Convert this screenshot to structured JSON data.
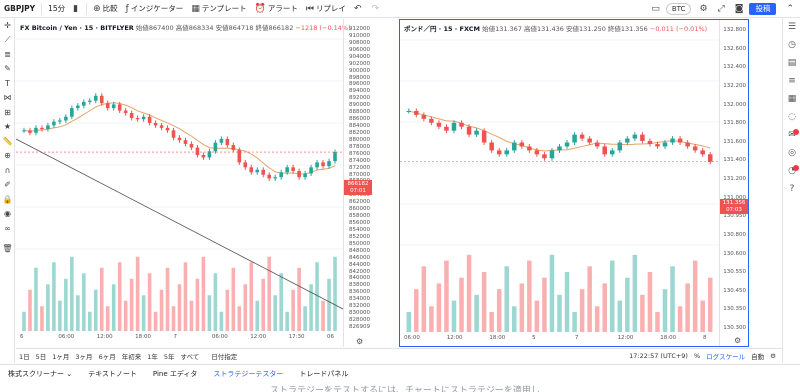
{
  "toolbar": {
    "symbol": "GBPJPY",
    "interval": "15分",
    "compare": "比較",
    "indicators": "インジケーター",
    "templates": "テンプレート",
    "alert": "アラート",
    "replay": "リプレイ",
    "currency": "BTC",
    "post": "投稿"
  },
  "pane1": {
    "legend_symbol": "FX Bitcoin / Yen · 15 · BITFLYER",
    "legend_values": "始値867400  高値868334  安値864718  終値866182",
    "legend_change": "−1218 (−0.14%)",
    "yticks": [
      "912000",
      "910000",
      "908000",
      "906000",
      "904000",
      "902000",
      "900000",
      "898000",
      "896000",
      "894000",
      "892000",
      "890000",
      "888000",
      "886000",
      "884000",
      "882000",
      "880000",
      "878000",
      "876000",
      "874000",
      "872000",
      "870000",
      "868000",
      "866000",
      "864000",
      "862000",
      "860000",
      "858000",
      "856000",
      "854000",
      "852000",
      "850000",
      "848000",
      "846000",
      "844000",
      "842000",
      "840000",
      "838000",
      "836000",
      "834000",
      "832000",
      "830000",
      "828000",
      "826909"
    ],
    "xticks": [
      "6",
      "06:00",
      "12:00",
      "18:00",
      "7",
      "06:00",
      "12:00",
      "17:30",
      "06"
    ],
    "price_tag": "866182",
    "price_tag_time": "07:01"
  },
  "pane2": {
    "legend_symbol": "ポンド／円 · 15 · FXCM",
    "legend_values": "始値131.367  高値131.436  安値131.250  終値131.356",
    "legend_change": "−0.011 (−0.01%)",
    "yticks": [
      "132.800",
      "132.600",
      "132.400",
      "132.200",
      "132.000",
      "131.800",
      "131.600",
      "131.400",
      "131.200",
      "131.000",
      "130.950",
      "130.800",
      "130.600",
      "130.550",
      "130.450",
      "130.350",
      "130.300"
    ],
    "xticks": [
      "06:00",
      "12:00",
      "18:00",
      "5",
      "7",
      "12:00",
      "18:00",
      "8"
    ],
    "price_tag": "131.356",
    "price_tag_time": "07:03"
  },
  "rangebar": {
    "ranges": [
      "1日",
      "5日",
      "1ヶ月",
      "3ヶ月",
      "6ヶ月",
      "年初来",
      "1年",
      "5年",
      "すべて"
    ],
    "goto": "日付指定",
    "time": "17:22:57 (UTC+9)",
    "percent": "%",
    "log": "ログスケール",
    "auto": "自動"
  },
  "bottom_tabs": [
    "株式スクリーナー",
    "テキストノート",
    "Pine エディタ",
    "ストラテジーテスター",
    "トレードパネル"
  ],
  "bottom_message": "ストラテジーをテストするには、チャートにストラテジーを適用し",
  "colors": {
    "up": "#26a69a",
    "down": "#ef5350",
    "accent": "#2962ff"
  },
  "chart_data": [
    {
      "type": "candlestick",
      "title": "FX Bitcoin / Yen · 15 · BITFLYER",
      "ylim": [
        826909,
        912000
      ],
      "close_series": [
        875000,
        874000,
        876000,
        875500,
        877000,
        878500,
        879000,
        880500,
        884000,
        885000,
        886500,
        887000,
        889000,
        886000,
        884000,
        885500,
        883000,
        882000,
        880000,
        879500,
        880500,
        878000,
        877000,
        876000,
        875000,
        872000,
        871000,
        869500,
        868000,
        865000,
        864000,
        866500,
        870000,
        871500,
        869000,
        867000,
        862000,
        860000,
        858000,
        859000,
        857000,
        855500,
        856000,
        858000,
        860000,
        858500,
        856000,
        857500,
        860000,
        862000,
        860500,
        862500,
        866182
      ]
    },
    {
      "type": "candlestick",
      "title": "ポンド／円 · 15 · FXCM",
      "ylim": [
        130.3,
        132.9
      ],
      "close_series": [
        132.0,
        131.95,
        131.9,
        131.85,
        131.8,
        131.75,
        131.85,
        131.8,
        131.7,
        131.75,
        131.6,
        131.5,
        131.45,
        131.5,
        131.6,
        131.55,
        131.5,
        131.45,
        131.4,
        131.5,
        131.55,
        131.6,
        131.7,
        131.65,
        131.6,
        131.55,
        131.45,
        131.5,
        131.6,
        131.65,
        131.7,
        131.62,
        131.58,
        131.55,
        131.6,
        131.65,
        131.6,
        131.55,
        131.5,
        131.45,
        131.356
      ]
    }
  ]
}
